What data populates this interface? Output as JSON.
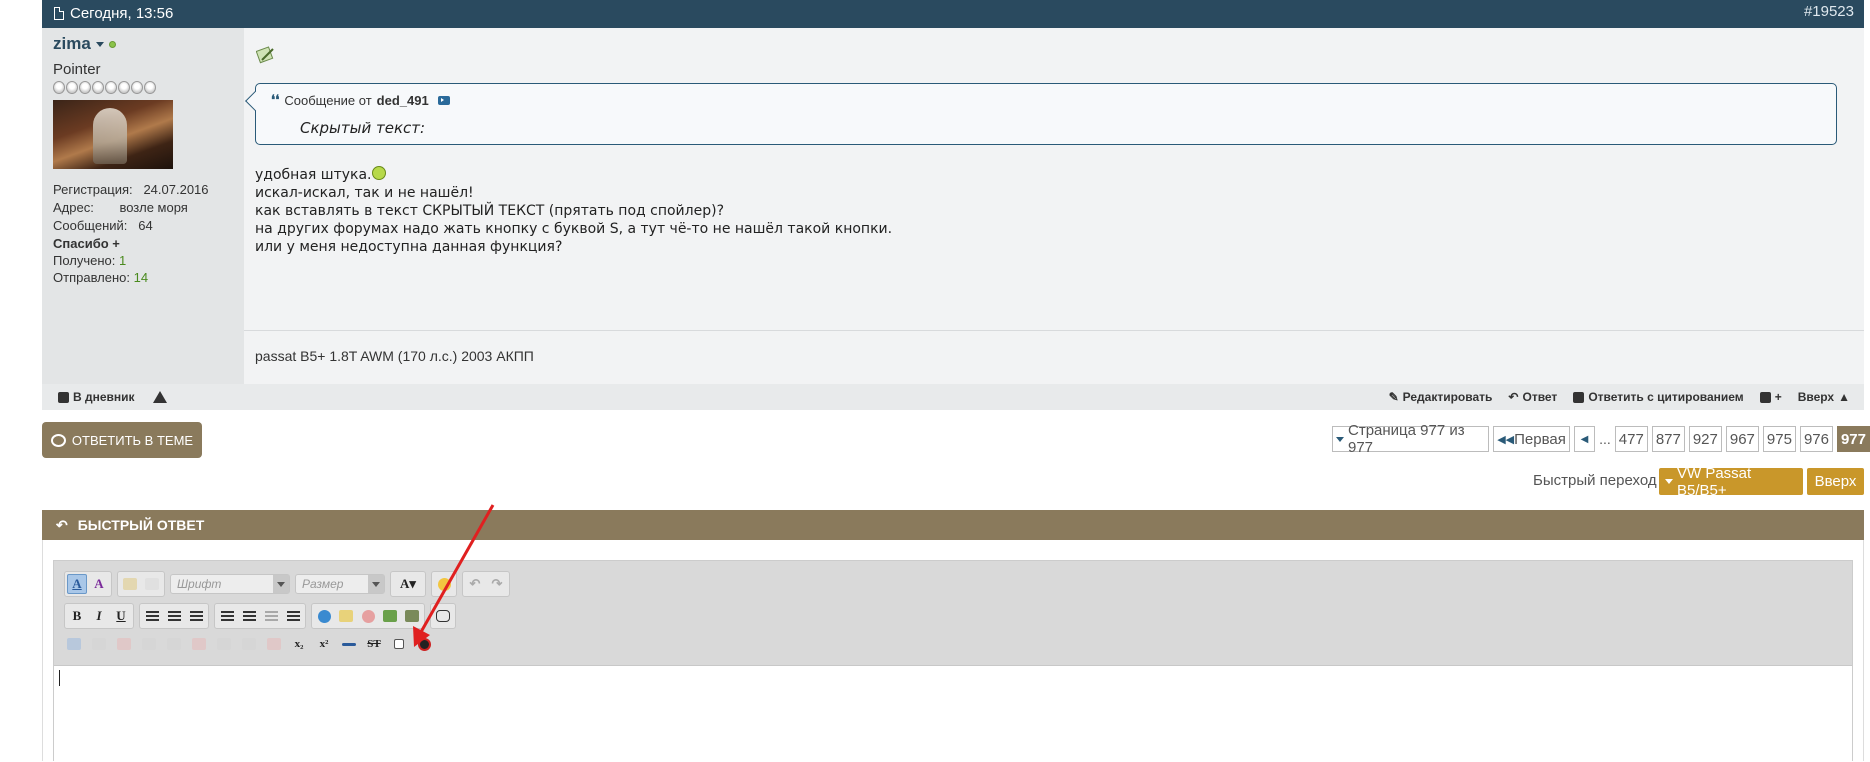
{
  "post": {
    "date": "Сегодня, 13:56",
    "number": "#19523",
    "user": {
      "name": "zima",
      "title": "Pointer",
      "reg_label": "Регистрация:",
      "reg_value": "24.07.2016",
      "addr_label": "Адрес:",
      "addr_value": "возле моря",
      "msgs_label": "Сообщений:",
      "msgs_value": "64",
      "thanks_label": "Спасибо +",
      "received_label": "Получено:",
      "received_value": "1",
      "sent_label": "Отправлено:",
      "sent_value": "14"
    },
    "quote": {
      "prefix": "Сообщение от",
      "author": "ded_491",
      "text": "Скрытый текст:"
    },
    "message_lines": [
      "удобная штука.",
      "искал-искал, так и не нашёл!",
      "как вставлять в текст СКРЫТЫЙ ТЕКСТ (прятать под спойлер)?",
      "на других форумах надо жать кнопку с буквой S, а тут чё-то не нашёл такой кнопки.",
      "или у меня недоступна данная функция?"
    ],
    "signature": "passat B5+ 1.8T AWM (170 л.с.) 2003 АКПП",
    "footer": {
      "diary": "В дневник",
      "edit": "Редактировать",
      "reply": "Ответ",
      "reply_quote": "Ответить с цитированием",
      "top": "Вверх"
    }
  },
  "actions": {
    "reply_in_thread": "ОТВЕТИТЬ В ТЕМЕ",
    "page_label": "Страница 977 из 977",
    "first": "Первая",
    "dots": "...",
    "pages": [
      "477",
      "877",
      "927",
      "967",
      "975",
      "976"
    ],
    "current_page": "977",
    "jump_label": "Быстрый переход",
    "jump_value": "VW Passat B5/B5+",
    "up": "Вверх"
  },
  "quick_reply": {
    "title": "БЫСТРЫЙ ОТВЕТ",
    "font_placeholder": "Шрифт",
    "size_placeholder": "Размер"
  },
  "colors": {
    "header_bg": "#2a4a5f",
    "accent_brown": "#8a7a5c",
    "accent_gold": "#c9972a",
    "annotation_arrow": "#e02020"
  }
}
